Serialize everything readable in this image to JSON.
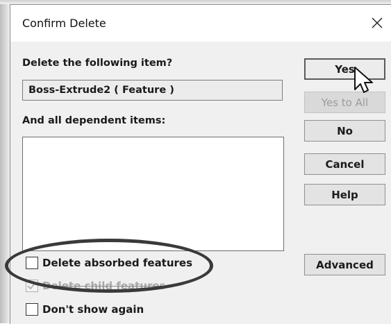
{
  "dialog": {
    "title": "Confirm Delete",
    "close_glyph": "✕"
  },
  "main": {
    "prompt_label": "Delete the following item?",
    "item_value": "Boss-Extrude2 ( Feature )",
    "dependents_label": "And all dependent items:",
    "dependents": []
  },
  "buttons": {
    "yes": "Yes",
    "yes_to_all": "Yes to All",
    "no": "No",
    "cancel": "Cancel",
    "help": "Help",
    "advanced": "Advanced"
  },
  "options": {
    "delete_absorbed": {
      "label": "Delete absorbed features",
      "checked": false,
      "enabled": true
    },
    "delete_child": {
      "label": "Delete child features",
      "checked": true,
      "enabled": false
    },
    "dont_show": {
      "label": "Don't show again",
      "checked": false,
      "enabled": true
    }
  },
  "icons": {
    "close": "close-icon",
    "cursor": "mouse-pointer-icon",
    "check": "checkmark-icon"
  }
}
